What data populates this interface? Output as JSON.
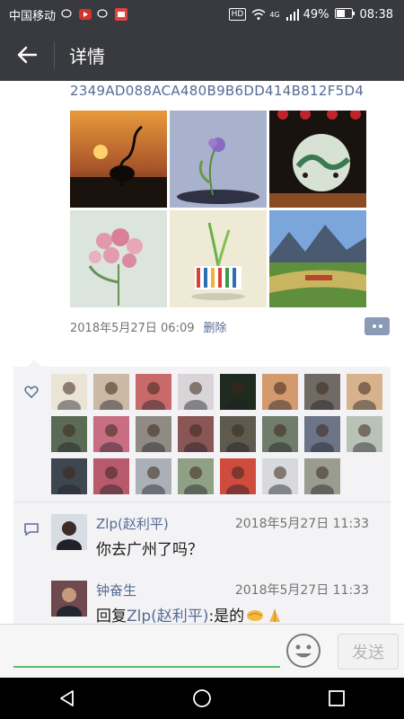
{
  "status_bar": {
    "carrier": "中国移动",
    "battery": "49%",
    "time": "08:38",
    "badge": "HD",
    "signal_label": "4G"
  },
  "app_bar": {
    "title": "详情",
    "back_icon": "arrow-left-icon"
  },
  "post": {
    "hash": "2349AD088ACA480B9B6DD414B812F5D4",
    "photos": [
      {
        "subject": "crane silhouette at sunset",
        "colors": [
          "#c9762d",
          "#1e1a14"
        ]
      },
      {
        "subject": "purple flower on dark dish",
        "colors": [
          "#a7b0cc",
          "#3a3d52"
        ]
      },
      {
        "subject": "jade pendant with red lanterns",
        "colors": [
          "#1a1612",
          "#c8d6c6"
        ]
      },
      {
        "subject": "pink roses in glass",
        "colors": [
          "#d9e4dd",
          "#d7889c"
        ]
      },
      {
        "subject": "green sprout in striped cup",
        "colors": [
          "#f0ecd7",
          "#7cbf4a"
        ]
      },
      {
        "subject": "mountain valley village",
        "colors": [
          "#7aa0d2",
          "#5b8a3a"
        ]
      }
    ],
    "date": "2018年5月27日 06:09",
    "delete_label": "删除",
    "comment_icon": "more-dots-icon"
  },
  "likes": {
    "icon": "heart-icon",
    "avatars": [
      "#e9e4d6",
      "#cbb8a5",
      "#c96a6a",
      "#d8d4d8",
      "#1f2b1e",
      "#d29a6d",
      "#6f6a63",
      "#d7b28c",
      "#5a6a54",
      "#c86e83",
      "#8f8a84",
      "#8a5555",
      "#5e5a4e",
      "#6f7d6a",
      "#6d7488",
      "#b9c2b7",
      "#3e4650",
      "#b65a6c",
      "#aab0b6",
      "#8fa085",
      "#cf4b3e",
      "#d7d9dc",
      "#9a9c90"
    ]
  },
  "comments": [
    {
      "name": "Zlp(赵利平)",
      "time": "2018年5月27日 11:33",
      "text": "你去广州了吗？",
      "avatar_color": "#d8dde3"
    },
    {
      "name": "钟奋生",
      "time": "2018年5月27日 11:33",
      "reply_prefix": "回复",
      "reply_to": "Zlp(赵利平)",
      "text": ":是的",
      "emoji_icons": [
        "handshake-icon",
        "praying-hands-icon"
      ],
      "avatar_color": "#6e4a4e"
    }
  ],
  "input_bar": {
    "placeholder": "",
    "emoji_icon": "smiley-icon",
    "send_label": "发送"
  },
  "nav_bar": {
    "back": "nav-back-icon",
    "home": "nav-home-icon",
    "recents": "nav-recents-icon"
  },
  "colors": {
    "accent_link": "#576b95",
    "input_underline": "#57be6a",
    "bar_bg": "#393a3f"
  }
}
